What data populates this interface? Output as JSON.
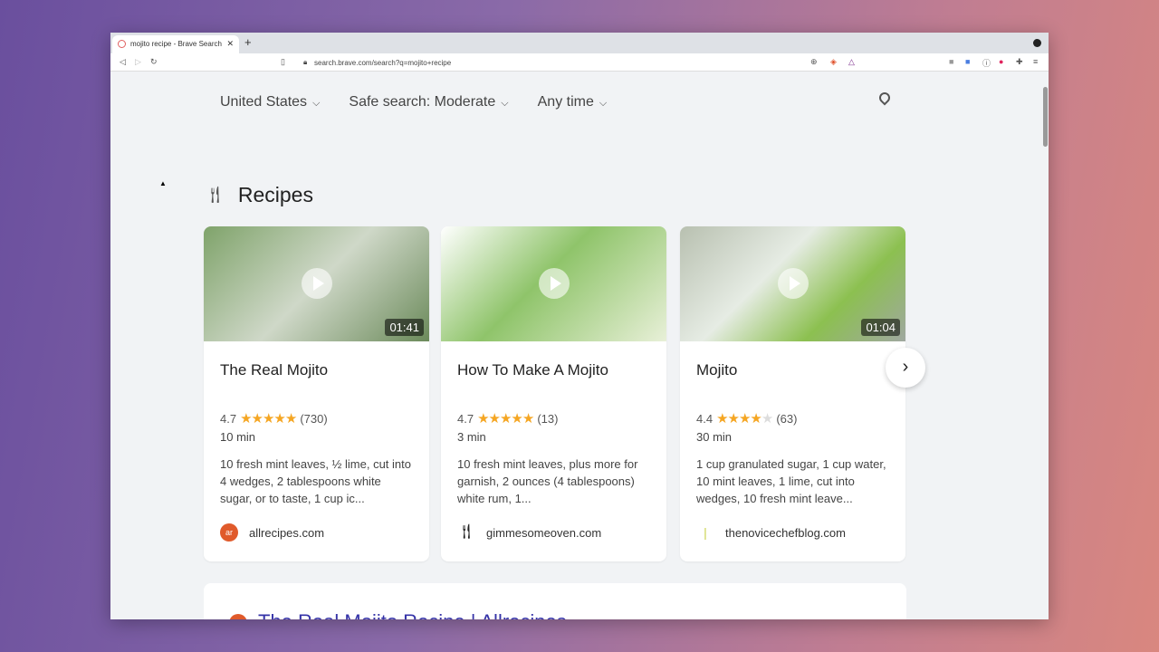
{
  "browser": {
    "tab_title": "mojito recipe - Brave Search",
    "url": "search.brave.com/search?q=mojito+recipe"
  },
  "filters": [
    {
      "label": "United States"
    },
    {
      "label": "Safe search: Moderate"
    },
    {
      "label": "Any time"
    }
  ],
  "section_title": "Recipes",
  "recipes": [
    {
      "title": "The Real Mojito",
      "rating": "4.7",
      "stars": 4.7,
      "reviews": "(730)",
      "time": "10 min",
      "duration": "01:41",
      "description": "10 fresh mint leaves, ½ lime, cut into 4 wedges, 2 tablespoons white sugar, or to taste, 1 cup ic...",
      "source": "allrecipes.com",
      "color": "#e05a2b"
    },
    {
      "title": "How To Make A Mojito",
      "rating": "4.7",
      "stars": 4.7,
      "reviews": "(13)",
      "time": "3 min",
      "duration": "",
      "description": "10 fresh mint leaves, plus more for garnish, 2 ounces (4 tablespoons) white rum, 1...",
      "source": "gimmesomeoven.com",
      "color": "#222222"
    },
    {
      "title": "Mojito",
      "rating": "4.4",
      "stars": 4.4,
      "reviews": "(63)",
      "time": "30 min",
      "duration": "01:04",
      "description": "1 cup granulated sugar, 1 cup water, 10 mint leaves, 1 lime, cut into wedges, 10 fresh mint leave...",
      "source": "thenovicechefblog.com",
      "color": "#c8d24a"
    }
  ],
  "first_result": {
    "title": "The Real Mojito Recipe | Allrecipes"
  }
}
